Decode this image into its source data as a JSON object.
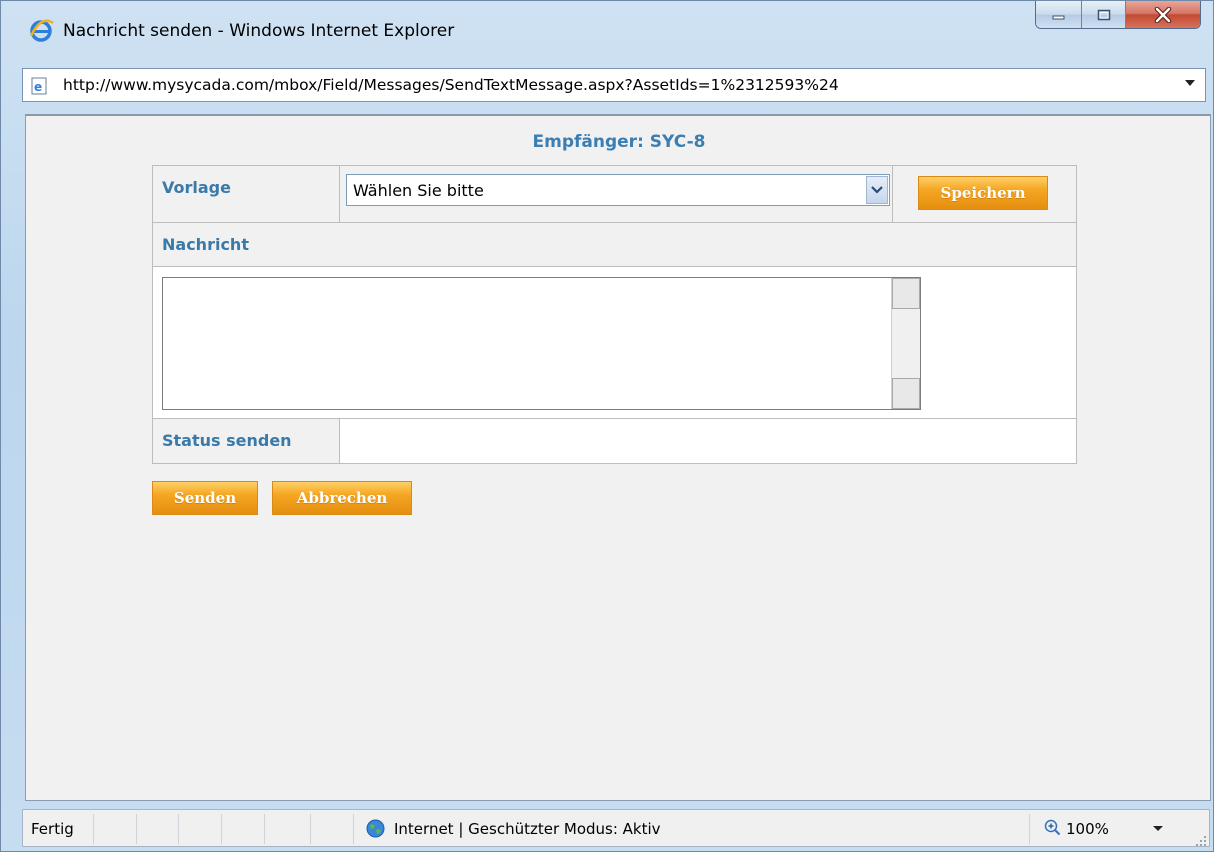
{
  "window": {
    "title": "Nachricht senden - Windows Internet Explorer",
    "controls": {
      "minimize": "minimize",
      "maximize": "maximize",
      "close": "close"
    }
  },
  "addressbar": {
    "url": "http://www.mysycada.com/mbox/Field/Messages/SendTextMessage.aspx?AssetIds=1%2312593%24"
  },
  "page": {
    "recipient": "Empfänger: SYC-8",
    "form": {
      "template_label": "Vorlage",
      "template_select_value": "Wählen Sie bitte",
      "save_button": "Speichern",
      "message_label": "Nachricht",
      "message_value": "",
      "status_label": "Status senden",
      "status_value": ""
    },
    "send_button": "Senden",
    "cancel_button": "Abbrechen"
  },
  "statusbar": {
    "status_text": "Fertig",
    "zone_text": "Internet | Geschützter Modus: Aktiv",
    "zoom": "100%"
  },
  "colors": {
    "label_blue": "#3a7aa9",
    "accent_orange": "#f5a623",
    "close_red": "#c34a33"
  }
}
